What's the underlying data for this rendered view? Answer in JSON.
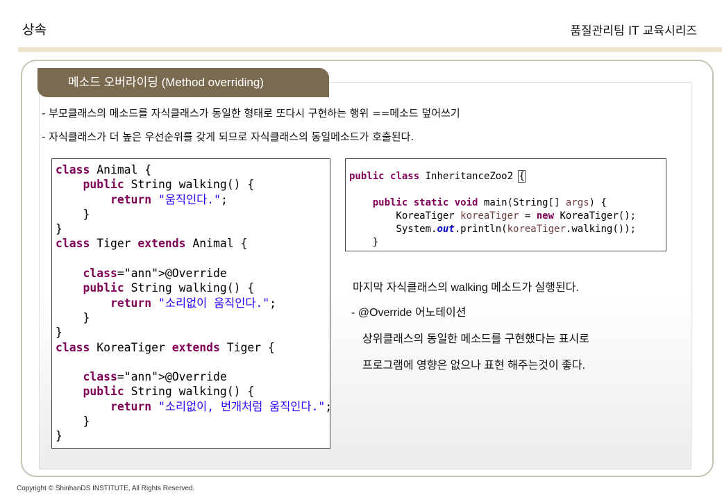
{
  "header": {
    "title": "상속",
    "series": "품질관리팀 IT 교육시리즈"
  },
  "section": {
    "tab_label": "메소드 오버라이딩 (Method overriding)"
  },
  "bullets": [
    "- 부모클래스의 메소드를 자식클래스가 동일한 형태로 또다시 구현하는 행위 ==메소드 덮어쓰기",
    "- 자식클래스가  더 높은 우선순위를 갖게 되므로 자식클래스의 동일메소드가 호출된다."
  ],
  "code_left": {
    "lines": [
      "class Animal {",
      "    public String walking() {",
      "        return \"움직인다.\";",
      "    }",
      "}",
      "class Tiger extends Animal {",
      "",
      "    @Override",
      "    public String walking() {",
      "        return \"소리없이 움직인다.\";",
      "    }",
      "}",
      "class KoreaTiger extends Tiger {",
      "",
      "    @Override",
      "    public String walking() {",
      "        return \"소리없이, 번개처럼 움직인다.\";",
      "    }",
      "}"
    ]
  },
  "code_right": {
    "lines": [
      "public class InheritanceZoo2 {",
      "",
      "    public static void main(String[] args) {",
      "        KoreaTiger koreaTiger = new KoreaTiger();",
      "        System.out.println(koreaTiger.walking());",
      "    }"
    ]
  },
  "description": {
    "line1": "마지막 자식클래스의 walking 메소드가 실행된다.",
    "line2": "- @Override  어노테이션",
    "line3": "상위클래스의 동일한 메소드를 구현했다는 표시로",
    "line4": "프로그램에 영향은 없으나 표현 해주는것이 좋다."
  },
  "footer": {
    "copyright": "Copyright © ShinhanDS INSTITUTE, All Rights Reserved."
  }
}
